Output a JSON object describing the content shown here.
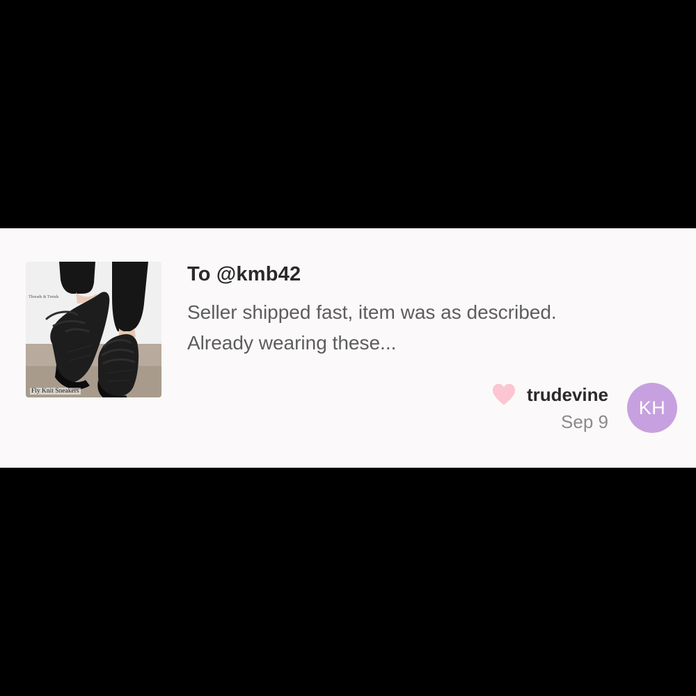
{
  "review": {
    "recipient": "To @kmb42",
    "message_line1": "Seller shipped fast, item was as described.",
    "message_line2": "Already wearing these...",
    "product_image": {
      "brand_text": "Threads & Trends",
      "caption": "Fly Knit Sneakers"
    },
    "reviewer": {
      "username": "trudevine",
      "date": "Sep 9",
      "avatar_initials": "KH"
    },
    "like_icon": "heart-icon"
  },
  "colors": {
    "background": "#000000",
    "card_background": "#fbf9fa",
    "avatar_background": "#c7a1df",
    "heart": "#fbc6cf",
    "title_text": "#2a2a2a",
    "body_text": "#5d5d5d",
    "date_text": "#8a8a8a"
  }
}
